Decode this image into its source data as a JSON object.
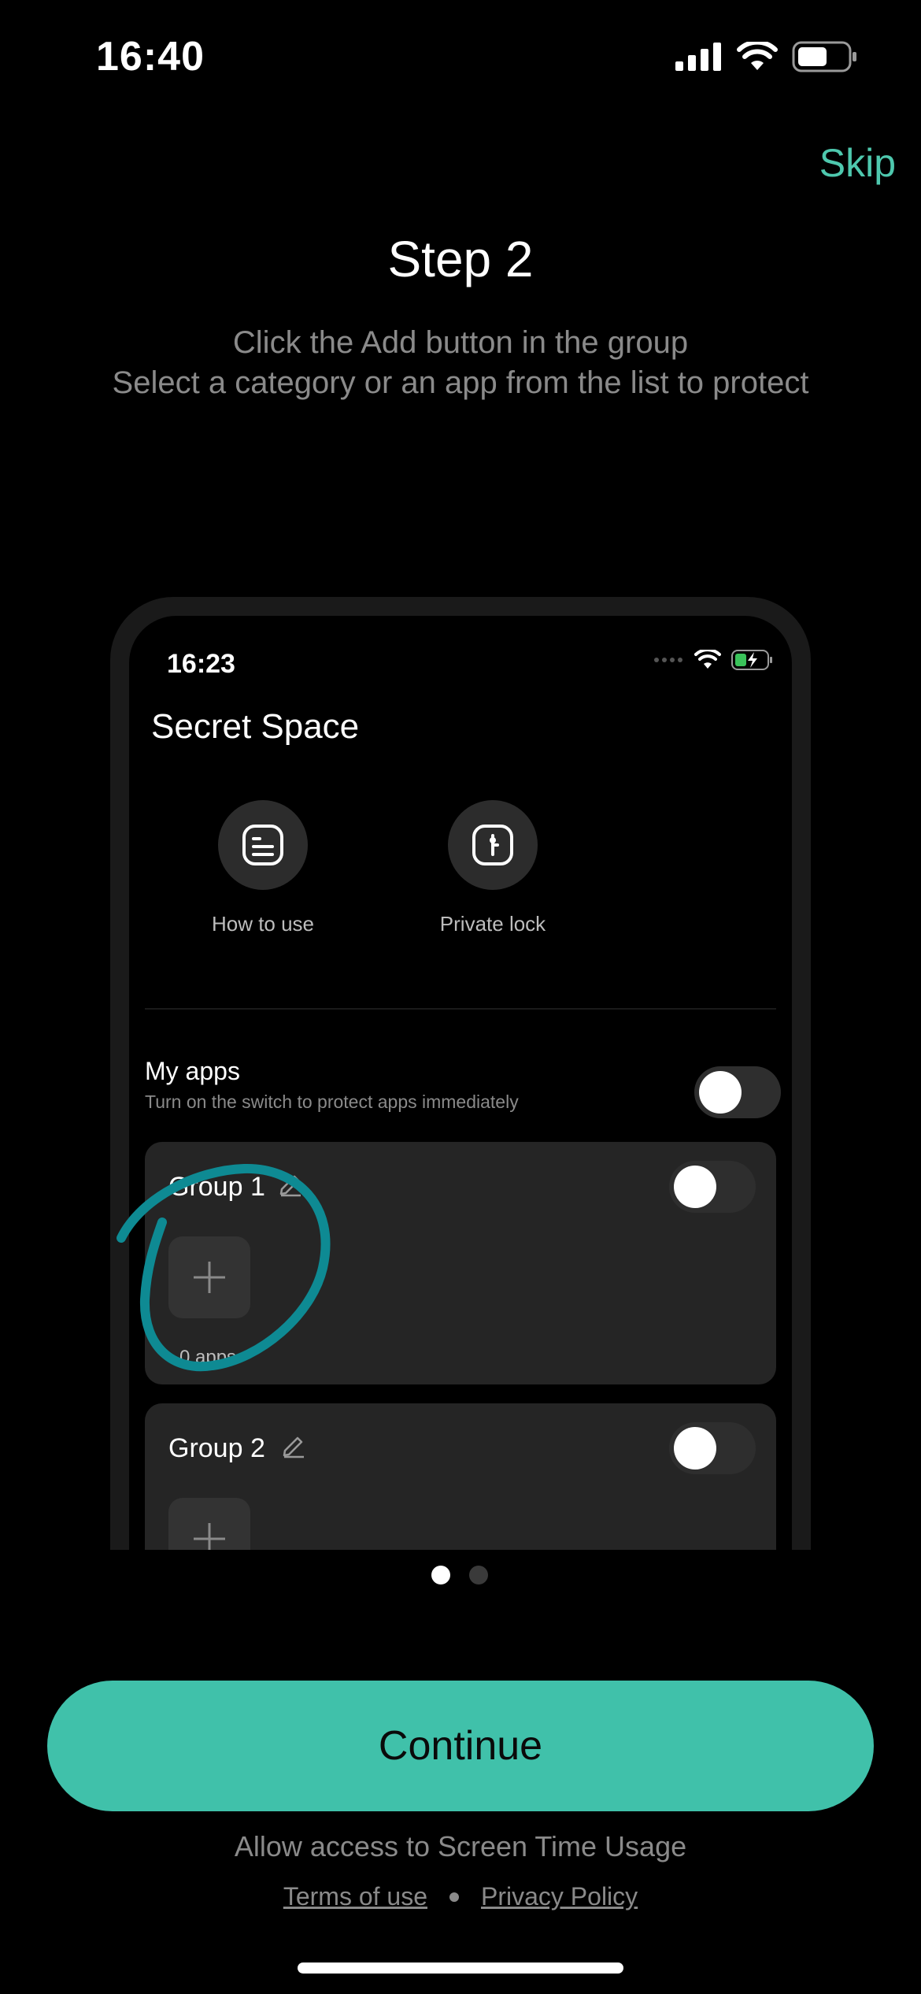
{
  "status_bar": {
    "time": "16:40"
  },
  "header": {
    "skip_label": "Skip"
  },
  "step": {
    "title": "Step 2",
    "line1": "Click the Add button in the group",
    "line2": "Select a category or an app from the list to protect"
  },
  "mockup": {
    "time": "16:23",
    "title": "Secret Space",
    "features": [
      {
        "label": "How to use",
        "icon": "guide-icon"
      },
      {
        "label": "Private lock",
        "icon": "lock-icon"
      }
    ],
    "my_apps": {
      "title": "My apps",
      "subtitle": "Turn on the switch to protect apps immediately",
      "enabled": false
    },
    "groups": [
      {
        "name": "Group 1",
        "count": "0 apps",
        "enabled": false
      },
      {
        "name": "Group 2",
        "enabled": false
      }
    ]
  },
  "pagination": {
    "current": 1,
    "total": 2
  },
  "footer": {
    "continue_label": "Continue",
    "access_text": "Allow access to Screen Time Usage",
    "terms_label": "Terms of use",
    "privacy_label": "Privacy Policy"
  },
  "colors": {
    "accent": "#40c1aa",
    "annotation": "#0e8a93"
  }
}
